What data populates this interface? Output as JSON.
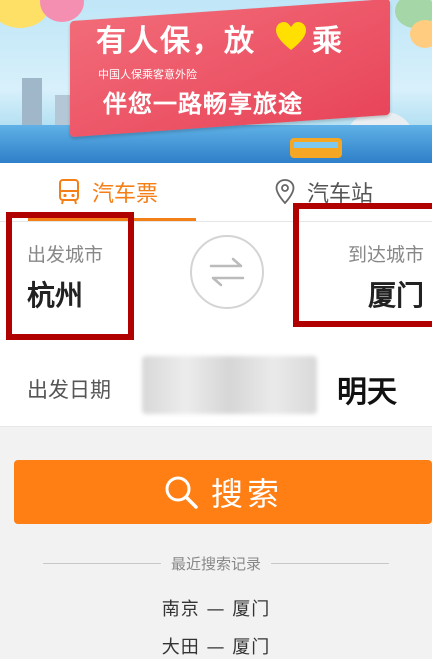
{
  "banner": {
    "line1_left": "有人保，放",
    "line1_right": "乘",
    "subtitle": "中国人保乘客意外险",
    "line2": "伴您一路畅享旅途",
    "icons": [
      "heart-icon",
      "bus-illustration"
    ]
  },
  "tabs": [
    {
      "label": "汽车票",
      "icon": "bus-icon",
      "active": true,
      "color": "#f57f17"
    },
    {
      "label": "汽车站",
      "icon": "location-pin-icon",
      "active": false
    }
  ],
  "route": {
    "from_label": "出发城市",
    "from_city": "杭州",
    "to_label": "到达城市",
    "to_city": "厦门",
    "swap_icon": "swap-arrows-icon"
  },
  "date": {
    "label": "出发日期",
    "value": "明天"
  },
  "search": {
    "label": "搜索",
    "icon": "search-icon",
    "color": "#ff7f14"
  },
  "recent": {
    "header": "最近搜索记录",
    "items": [
      "南京 — 厦门",
      "大田 — 厦门"
    ]
  }
}
